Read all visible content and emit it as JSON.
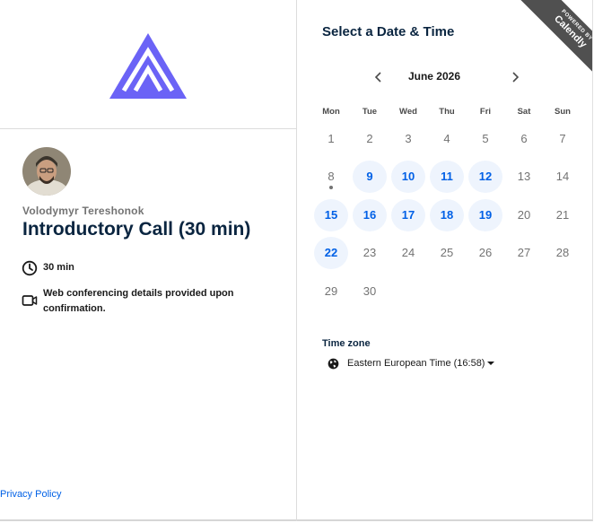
{
  "left_panel": {
    "host_name": "Volodymyr Tereshonok",
    "event_title": "Introductory Call (30 min)",
    "duration": "30 min",
    "conferencing": "Web conferencing details provided upon confirmation.",
    "privacy_link": "Privacy Policy",
    "logo_color": "#6b63f6"
  },
  "right_panel": {
    "title": "Select a Date & Time",
    "month": "June 2026",
    "prev_icon": "chevron-left-icon",
    "next_icon": "chevron-right-icon",
    "weekdays": [
      "Mon",
      "Tue",
      "Wed",
      "Thu",
      "Fri",
      "Sat",
      "Sun"
    ],
    "weeks": [
      [
        {
          "d": "1",
          "a": false
        },
        {
          "d": "2",
          "a": false
        },
        {
          "d": "3",
          "a": false
        },
        {
          "d": "4",
          "a": false
        },
        {
          "d": "5",
          "a": false
        },
        {
          "d": "6",
          "a": false
        },
        {
          "d": "7",
          "a": false
        }
      ],
      [
        {
          "d": "8",
          "a": false,
          "today": true
        },
        {
          "d": "9",
          "a": true
        },
        {
          "d": "10",
          "a": true
        },
        {
          "d": "11",
          "a": true
        },
        {
          "d": "12",
          "a": true
        },
        {
          "d": "13",
          "a": false
        },
        {
          "d": "14",
          "a": false
        }
      ],
      [
        {
          "d": "15",
          "a": true
        },
        {
          "d": "16",
          "a": true
        },
        {
          "d": "17",
          "a": true
        },
        {
          "d": "18",
          "a": true
        },
        {
          "d": "19",
          "a": true
        },
        {
          "d": "20",
          "a": false
        },
        {
          "d": "21",
          "a": false
        }
      ],
      [
        {
          "d": "22",
          "a": true
        },
        {
          "d": "23",
          "a": false
        },
        {
          "d": "24",
          "a": false
        },
        {
          "d": "25",
          "a": false
        },
        {
          "d": "26",
          "a": false
        },
        {
          "d": "27",
          "a": false
        },
        {
          "d": "28",
          "a": false
        }
      ],
      [
        {
          "d": "29",
          "a": false
        },
        {
          "d": "30",
          "a": false
        }
      ]
    ],
    "timezone_label": "Time zone",
    "timezone_value": "Eastern European Time (16:58)",
    "accent_color": "#0060e6"
  },
  "badge": {
    "line1": "POWERED BY",
    "line2": "Calendly"
  }
}
